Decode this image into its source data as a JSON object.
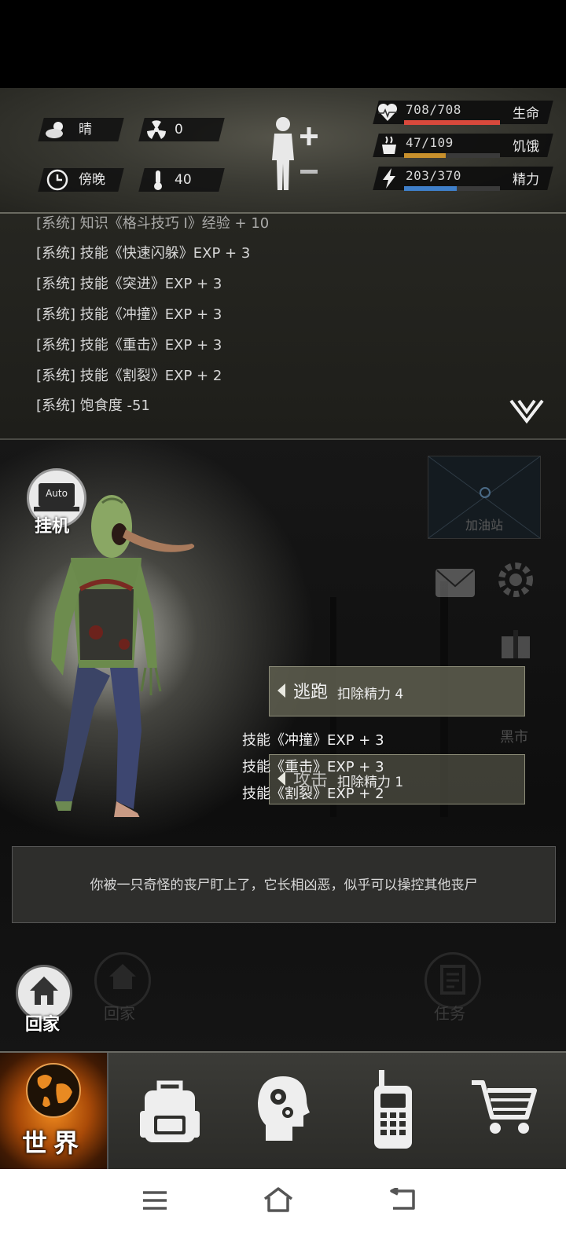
{
  "status": {
    "weather": {
      "icon": "cloud-sun-icon",
      "label": "晴"
    },
    "radiation": {
      "icon": "radiation-icon",
      "value": "0"
    },
    "time_of_day": {
      "icon": "clock-icon",
      "label": "傍晚"
    },
    "temperature": {
      "icon": "thermometer-icon",
      "value": "40"
    }
  },
  "vitals": {
    "health": {
      "value": "708/708",
      "label": "生命",
      "current": 708,
      "max": 708,
      "color": "#d9493c",
      "icon": "heart-pulse-icon"
    },
    "hunger": {
      "value": "47/109",
      "label": "饥饿",
      "current": 47,
      "max": 109,
      "color": "#c8902c",
      "icon": "food-icon"
    },
    "energy": {
      "value": "203/370",
      "label": "精力",
      "current": 203,
      "max": 370,
      "color": "#3f7fc9",
      "icon": "lightning-icon"
    }
  },
  "log": {
    "lines": [
      "[系统] 知识《格斗技巧 I》经验 + 10",
      "[系统] 技能《快速闪躲》EXP + 3",
      "[系统] 技能《突进》EXP + 3",
      "[系统] 技能《冲撞》EXP + 3",
      "[系统] 技能《重击》EXP + 3",
      "[系统] 技能《割裂》EXP + 2",
      "[系统] 饱食度 -51"
    ]
  },
  "scene": {
    "auto_label": "Auto",
    "auto_caption": "挂机",
    "map_label": "加油站",
    "black_market_label": "黑市",
    "flee": {
      "title": "逃跑",
      "cost": "扣除精力 4"
    },
    "attack": {
      "title": "攻击",
      "cost": "扣除精力 1"
    },
    "overlay_lines": [
      "技能《冲撞》EXP + 3",
      "技能《重击》EXP + 3",
      "技能《割裂》EXP + 2"
    ],
    "description": "你被一只奇怪的丧尸盯上了，它长相凶恶，似乎可以操控其他丧尸",
    "home_label": "回家",
    "home_faded_label": "回家",
    "task_label": "任务"
  },
  "nav": {
    "world_label": "世界"
  }
}
